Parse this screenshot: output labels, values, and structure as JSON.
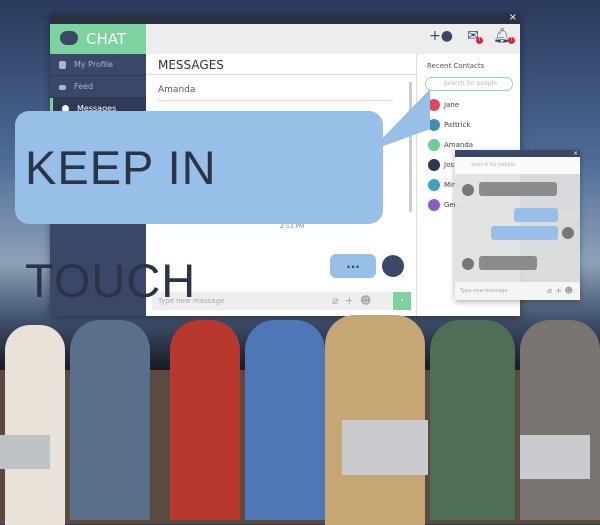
{
  "app": {
    "title": "CHAT",
    "close": "×"
  },
  "sidebar": {
    "items": [
      {
        "label": "My Profile",
        "icon": "user-icon"
      },
      {
        "label": "Feed",
        "icon": "menu-icon"
      },
      {
        "label": "Messages",
        "icon": "chat-icon"
      }
    ]
  },
  "main": {
    "heading": "MESSAGES",
    "conversation": "Amanda",
    "timestamp": "2:53 PM",
    "typing": "...",
    "input_placeholder": "Type new message",
    "send": "›"
  },
  "banner": {
    "text": "KEEP IN TOUCH"
  },
  "right": {
    "icons": [
      "add-user-icon",
      "mail-icon",
      "bell-icon"
    ],
    "badge": "!",
    "heading": "Recent Contacts",
    "search_placeholder": "Search for people",
    "contacts": [
      {
        "name": "Jane",
        "color": "#e0485a"
      },
      {
        "name": "Pattrick",
        "color": "#3f8fb0"
      },
      {
        "name": "Amanda",
        "color": "#6bcf94"
      },
      {
        "name": "Jos",
        "color": "#2d3550"
      },
      {
        "name": "Mira",
        "color": "#3fa0c0"
      },
      {
        "name": "Geo",
        "color": "#8a5cc8"
      }
    ]
  },
  "popup": {
    "close": "×",
    "search_placeholder": "Search for people",
    "input_placeholder": "Type new message"
  },
  "colors": {
    "accent": "#7dd3a0",
    "sidebar": "#3b4766",
    "bubble": "#97bfe8"
  }
}
